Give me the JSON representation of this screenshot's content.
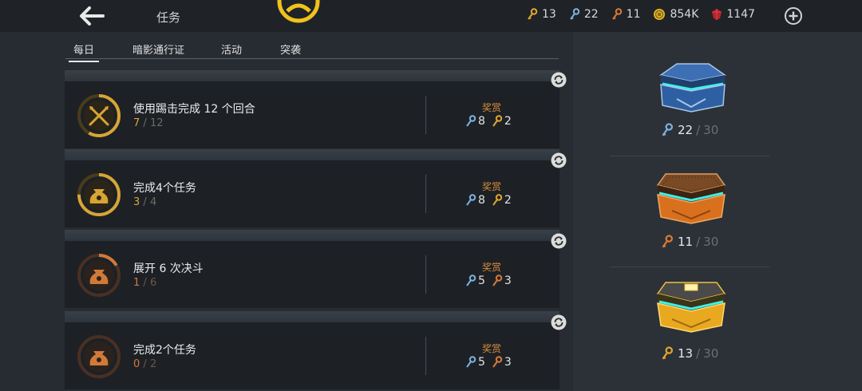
{
  "header": {
    "title": "任务",
    "currencies": [
      {
        "icon": "gold-key-icon",
        "color": "#e3a62a",
        "value": "13"
      },
      {
        "icon": "blue-key-icon",
        "color": "#7fb1dc",
        "value": "22"
      },
      {
        "icon": "bronze-key-icon",
        "color": "#d97a35",
        "value": "11"
      },
      {
        "icon": "coin-icon",
        "color": "#e0b62a",
        "value": "854K"
      },
      {
        "icon": "gem-icon",
        "color": "#b8232a",
        "value": "1147"
      }
    ]
  },
  "tabs": [
    {
      "label": "每日",
      "active": true
    },
    {
      "label": "暗影通行证",
      "active": false
    },
    {
      "label": "活动",
      "active": false
    },
    {
      "label": "突袭",
      "active": false
    }
  ],
  "quests": [
    {
      "title": "使用踢击完成 12 个回合",
      "current": "7",
      "sep": "/",
      "max": "12",
      "progress": 0.583,
      "icon": "crossed-swords-icon",
      "theme": "gold",
      "reward_label": "奖赏",
      "blue_keys": "8",
      "gold_keys": "2",
      "key2_icon": "gold-key-icon"
    },
    {
      "title": "完成4个任务",
      "current": "3",
      "sep": "/",
      "max": "4",
      "progress": 0.75,
      "icon": "money-bag-icon",
      "theme": "gold",
      "reward_label": "奖赏",
      "blue_keys": "8",
      "gold_keys": "2",
      "key2_icon": "gold-key-icon"
    },
    {
      "title": "展开 6 次决斗",
      "current": "1",
      "sep": "/",
      "max": "6",
      "progress": 0.167,
      "icon": "money-bag-icon",
      "theme": "orange",
      "reward_label": "奖赏",
      "blue_keys": "5",
      "gold_keys": "3",
      "key2_icon": "bronze-key-icon"
    },
    {
      "title": "完成2个任务",
      "current": "0",
      "sep": "/",
      "max": "2",
      "progress": 0,
      "icon": "money-bag-icon",
      "theme": "orange",
      "reward_label": "奖赏",
      "blue_keys": "5",
      "gold_keys": "3",
      "key2_icon": "bronze-key-icon"
    }
  ],
  "chests": [
    {
      "name": "blue-chest",
      "key_icon": "blue-key-icon",
      "key_color": "#7fb1dc",
      "value": "22",
      "sep": "/",
      "max": "30"
    },
    {
      "name": "bronze-chest",
      "key_icon": "bronze-key-icon",
      "key_color": "#d97a35",
      "value": "11",
      "sep": "/",
      "max": "30"
    },
    {
      "name": "gold-chest",
      "key_icon": "gold-key-icon",
      "key_color": "#e3a62a",
      "value": "13",
      "sep": "/",
      "max": "30"
    }
  ],
  "colors": {
    "gold": "#d6a534",
    "orange": "#d07a3a",
    "blue_key": "#7fb1dc"
  }
}
